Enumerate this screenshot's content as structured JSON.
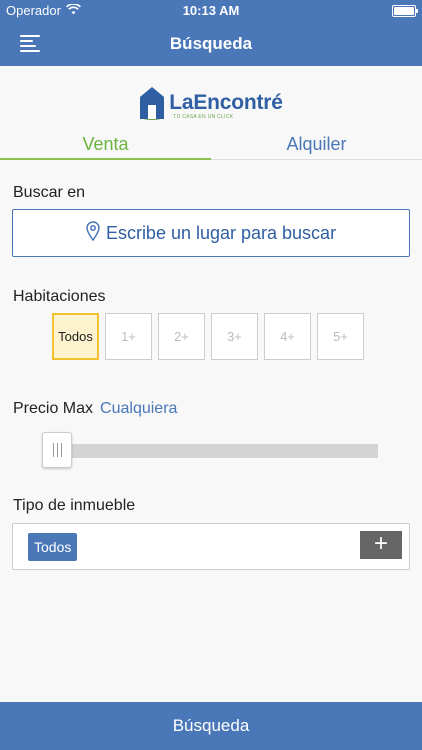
{
  "status_bar": {
    "carrier": "Operador",
    "time": "10:13 AM"
  },
  "nav": {
    "title": "Búsqueda"
  },
  "logo": {
    "name": "LaEncontré",
    "tagline": "TU CASA EN UN CLICK"
  },
  "tabs": [
    {
      "label": "Venta",
      "active": true
    },
    {
      "label": "Alquiler",
      "active": false
    }
  ],
  "search": {
    "label": "Buscar en",
    "placeholder": "Escribe un lugar para buscar"
  },
  "rooms": {
    "label": "Habitaciones",
    "options": [
      "Todos",
      "1+",
      "2+",
      "3+",
      "4+",
      "5+"
    ],
    "selected": "Todos"
  },
  "price": {
    "label": "Precio Max",
    "value": "Cualquiera",
    "slider_fraction": 0
  },
  "property_type": {
    "label": "Tipo de inmueble",
    "selected_chip": "Todos",
    "add_label": "+"
  },
  "bottom_button": {
    "label": "Búsqueda"
  },
  "colors": {
    "primary": "#4a77b8",
    "active_tab": "#6db33f",
    "selected_border": "#f2c230",
    "selected_bg": "#fdf3cf"
  }
}
